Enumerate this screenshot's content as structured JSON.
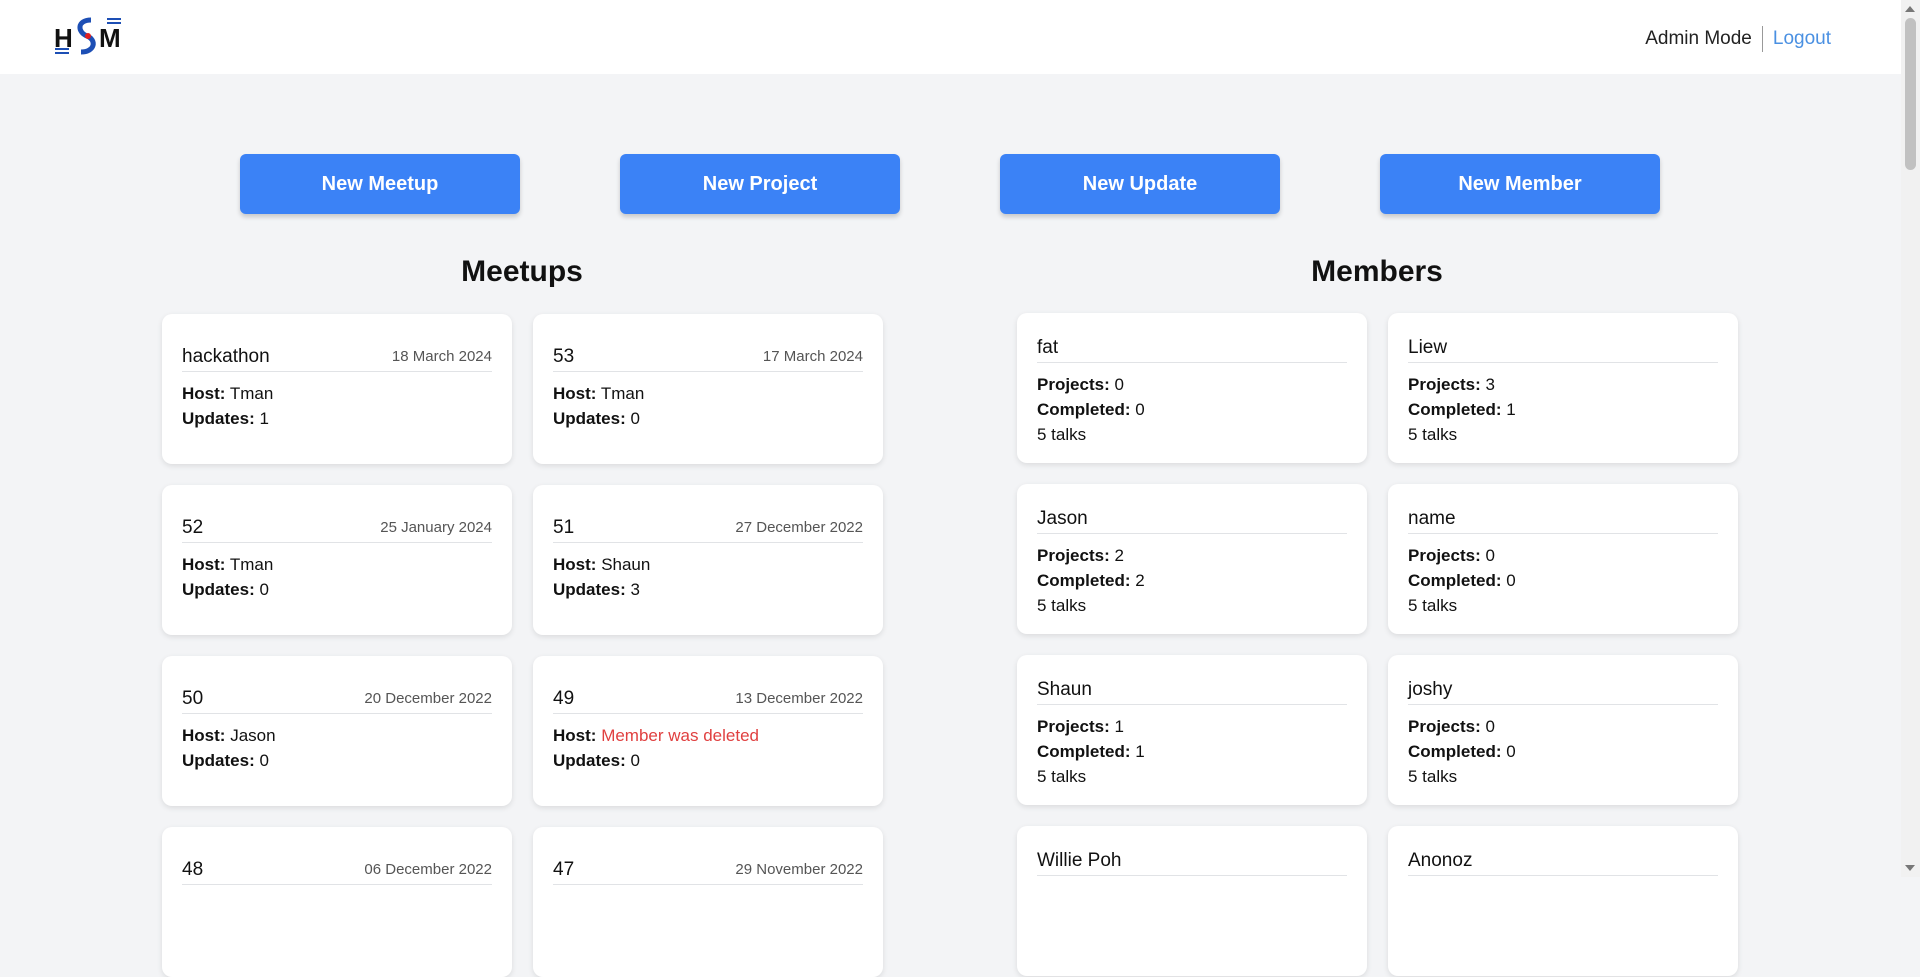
{
  "header": {
    "logo_text": "HSM",
    "admin_mode": "Admin Mode",
    "logout": "Logout"
  },
  "actions": {
    "new_meetup": "New Meetup",
    "new_project": "New Project",
    "new_update": "New Update",
    "new_member": "New Member"
  },
  "meetups": {
    "title": "Meetups",
    "host_label": "Host:",
    "updates_label": "Updates:",
    "items": [
      {
        "name": "hackathon",
        "date": "18 March 2024",
        "host": "Tman",
        "updates": "1"
      },
      {
        "name": "53",
        "date": "17 March 2024",
        "host": "Tman",
        "updates": "0"
      },
      {
        "name": "52",
        "date": "25 January 2024",
        "host": "Tman",
        "updates": "0"
      },
      {
        "name": "51",
        "date": "27 December 2022",
        "host": "Shaun",
        "updates": "3"
      },
      {
        "name": "50",
        "date": "20 December 2022",
        "host": "Jason",
        "updates": "0"
      },
      {
        "name": "49",
        "date": "13 December 2022",
        "host": "Member was deleted",
        "updates": "0"
      },
      {
        "name": "48",
        "date": "06 December 2022"
      },
      {
        "name": "47",
        "date": "29 November 2022"
      }
    ]
  },
  "members": {
    "title": "Members",
    "projects_label": "Projects:",
    "completed_label": "Completed:",
    "items": [
      {
        "name": "fat",
        "projects": "0",
        "completed": "0",
        "talks": "5 talks"
      },
      {
        "name": "Liew",
        "projects": "3",
        "completed": "1",
        "talks": "5 talks"
      },
      {
        "name": "Jason",
        "projects": "2",
        "completed": "2",
        "talks": "5 talks"
      },
      {
        "name": "name",
        "projects": "0",
        "completed": "0",
        "talks": "5 talks"
      },
      {
        "name": "Shaun",
        "projects": "1",
        "completed": "1",
        "talks": "5 talks"
      },
      {
        "name": "joshy",
        "projects": "0",
        "completed": "0",
        "talks": "5 talks"
      },
      {
        "name": "Willie Poh"
      },
      {
        "name": "Anonoz"
      }
    ]
  },
  "colors": {
    "accent": "#3b82f6",
    "link": "#4a90e2",
    "danger": "#e04040",
    "background": "#f3f4f6"
  }
}
